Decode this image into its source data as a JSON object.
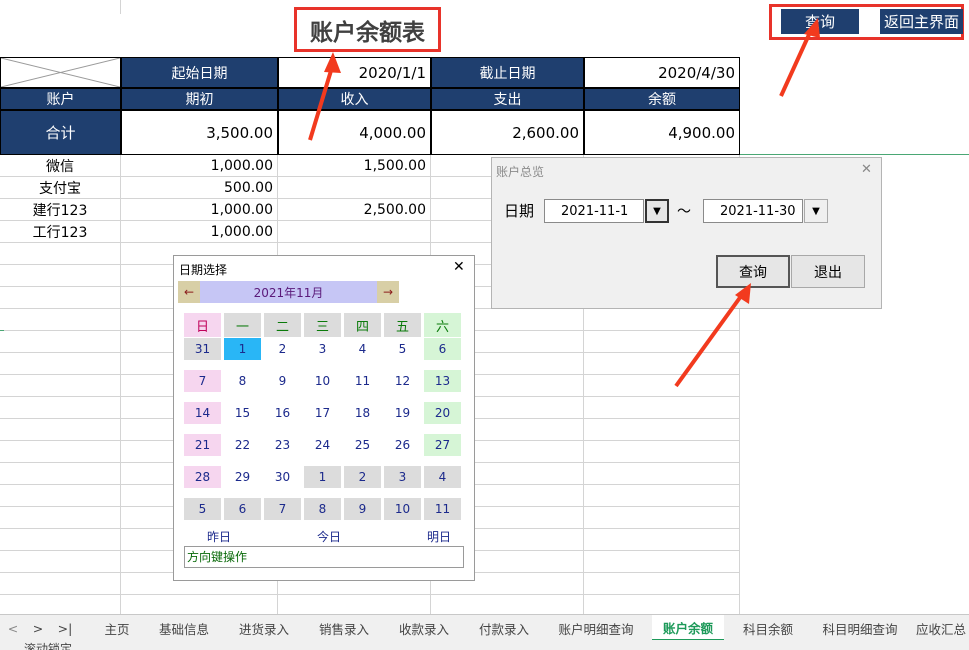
{
  "sheet": {
    "title": "账户余额表",
    "query_button": "查询",
    "home_button": "返回主界面",
    "start_label": "起始日期",
    "start_value": "2020/1/1",
    "end_label": "截止日期",
    "end_value": "2020/4/30",
    "columns": [
      "账户",
      "期初",
      "收入",
      "支出",
      "余额"
    ],
    "total": {
      "label": "合计",
      "opening": "3,500.00",
      "income": "4,000.00",
      "expense": "2,600.00",
      "balance": "4,900.00"
    },
    "rows": [
      {
        "account": "微信",
        "opening": "1,000.00",
        "income": "1,500.00"
      },
      {
        "account": "支付宝",
        "opening": "500.00",
        "income": ""
      },
      {
        "account": "建行123",
        "opening": "1,000.00",
        "income": "2,500.00"
      },
      {
        "account": "工行123",
        "opening": "1,000.00",
        "income": ""
      }
    ]
  },
  "overview_dialog": {
    "title": "账户总览",
    "close_glyph": "✕",
    "date_label": "日期",
    "from": "2021-11-1",
    "tilde": "～",
    "to": "2021-11-30",
    "dropdown_glyph": "▼",
    "query": "查询",
    "exit": "退出"
  },
  "date_picker": {
    "title": "日期选择",
    "close_glyph": "✕",
    "month": "2021年11月",
    "prev": "←",
    "next": "→",
    "weekdays": [
      "日",
      "一",
      "二",
      "三",
      "四",
      "五",
      "六"
    ],
    "weeks": [
      [
        "31",
        "1",
        "2",
        "3",
        "4",
        "5",
        "6"
      ],
      [
        "7",
        "8",
        "9",
        "10",
        "11",
        "12",
        "13"
      ],
      [
        "14",
        "15",
        "16",
        "17",
        "18",
        "19",
        "20"
      ],
      [
        "21",
        "22",
        "23",
        "24",
        "25",
        "26",
        "27"
      ],
      [
        "28",
        "29",
        "30",
        "1",
        "2",
        "3",
        "4"
      ],
      [
        "5",
        "6",
        "7",
        "8",
        "9",
        "10",
        "11"
      ]
    ],
    "yesterday": "昨日",
    "today": "今日",
    "tomorrow": "明日",
    "hint": "方向键操作"
  },
  "tabs": {
    "nav": [
      "<",
      ">",
      ">|"
    ],
    "items": [
      "主页",
      "基础信息",
      "进货录入",
      "销售录入",
      "收款录入",
      "付款录入",
      "账户明细查询",
      "账户余额",
      "科目余额",
      "科目明细查询",
      "应收汇总"
    ],
    "active_index": 7
  },
  "status": {
    "text": "滚动锁定"
  },
  "colors": {
    "navy": "#1f3f6f",
    "annotation_red": "#e8332a",
    "active_tab": "#1e9a5a"
  }
}
